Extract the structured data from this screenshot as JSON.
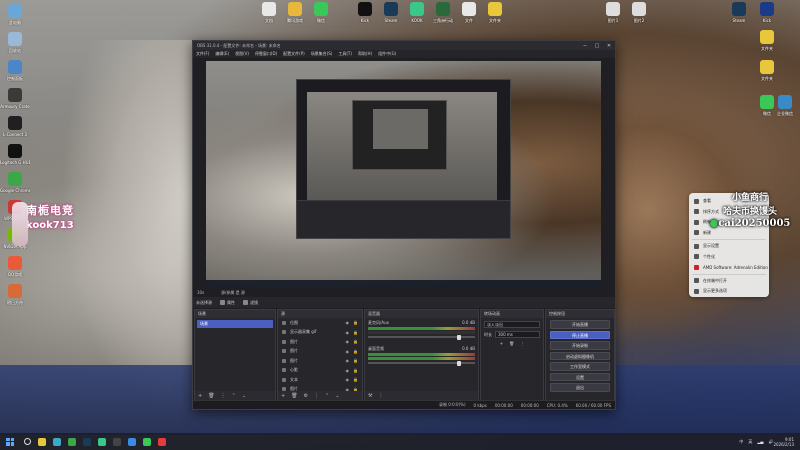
{
  "desktop": {
    "left_icons": [
      {
        "label": "此电脑",
        "color": "#6aa6d8"
      },
      {
        "label": "回收站",
        "color": "#9ab8d8"
      },
      {
        "label": "控制面板",
        "color": "#4a86c8"
      },
      {
        "label": "Armoury Crate",
        "color": "#3a3a3a"
      },
      {
        "label": "L-Connect 3",
        "color": "#202020"
      },
      {
        "label": "Logitech G HUB",
        "color": "#111"
      },
      {
        "label": "Google Chrome",
        "color": "#3aa848"
      },
      {
        "label": "WPS Office",
        "color": "#c83a3a"
      },
      {
        "label": "NVIDIA App",
        "color": "#76b900"
      },
      {
        "label": "QQ游戏",
        "color": "#e85a3a"
      },
      {
        "label": "明日方舟",
        "color": "#d86a3a"
      }
    ],
    "top_icons": [
      {
        "label": "文档",
        "color": "#e8e8e8"
      },
      {
        "label": "腾讯游戏",
        "color": "#e8b83a"
      },
      {
        "label": "微信",
        "color": "#3ac858"
      },
      {
        "label": "Kick",
        "color": "#111"
      },
      {
        "label": "Steam",
        "color": "#1a3a5a"
      },
      {
        "label": "KOOK",
        "color": "#3ac88a"
      },
      {
        "label": "三角洲行动",
        "color": "#2a6a3a"
      },
      {
        "label": "文件",
        "color": "#e8e8e8"
      },
      {
        "label": "文件夹",
        "color": "#e8c83a"
      }
    ],
    "right_icons": [
      {
        "label": "图片1",
        "color": "#ddd"
      },
      {
        "label": "图片2",
        "color": "#ddd"
      },
      {
        "label": "Steam",
        "color": "#1a3a5a"
      },
      {
        "label": "Kick",
        "color": "#1a3a8a"
      },
      {
        "label": "文件夹",
        "color": "#e8c83a"
      },
      {
        "label": "微信",
        "color": "#3ac858"
      },
      {
        "label": "文件夹",
        "color": "#e8c83a"
      },
      {
        "label": "企业微信",
        "color": "#3a8ac8"
      }
    ]
  },
  "overlay_left": {
    "line1": "南栀电竞",
    "line2": "kook713"
  },
  "overlay_right": {
    "line1": "小鱼商行",
    "line2": "哈夫币换馒头",
    "line3": "cai20250005"
  },
  "context_menu": {
    "items": [
      "查看",
      "排序方式",
      "刷新",
      "新建",
      "显示设置",
      "个性化",
      "AMD Software: Adrenalin Edition",
      "在终端中打开",
      "显示更多选项"
    ]
  },
  "obs": {
    "title": "OBS 31.0.4 - 配置文件: 未命名 - 场景: 未命名",
    "menu": [
      "文件(F)",
      "编辑(E)",
      "视图(V)",
      "停靠窗口(D)",
      "配置文件(P)",
      "场景集合(S)",
      "工具(T)",
      "帮助(H)",
      "组件中(G)"
    ],
    "tabs": [
      "10s",
      "源/参属 是 源"
    ],
    "sub_label": "未选择源",
    "sub_buttons": [
      "属性",
      "滤镜"
    ],
    "docks": {
      "scenes": {
        "title": "场景",
        "items": [
          "场景"
        ]
      },
      "sources": {
        "title": "源",
        "items": [
          "位图",
          "显示器采集 gif",
          "图片",
          "图片",
          "图片",
          "心脏",
          "文本",
          "图片"
        ]
      },
      "mixer": {
        "title": "混音器",
        "tracks": [
          {
            "name": "麦克风/Aux",
            "db": "0.0 dB"
          },
          {
            "name": "桌面音频",
            "db": "0.0 dB"
          }
        ]
      },
      "transitions": {
        "title": "转场动画",
        "type": "淡入淡出",
        "duration_label": "时长",
        "duration": "300 ms"
      },
      "controls": {
        "title": "控制按钮",
        "buttons": [
          "开始直播",
          "停止直播",
          "开始录制",
          "启动虚拟摄像机",
          "工作室模式",
          "设置",
          "退出"
        ]
      }
    },
    "status": [
      "录制 0:0:0(%)",
      "0 kbps",
      "00:00:00",
      "00:00:00",
      "CPU: 0.4%",
      "60.00 / 60.00 FPS"
    ]
  },
  "taskbar": {
    "apps": [
      {
        "name": "File Explorer",
        "color": "#e8c83a"
      },
      {
        "name": "Edge",
        "color": "#3aa8c8"
      },
      {
        "name": "Chrome",
        "color": "#3aa848"
      },
      {
        "name": "Steam",
        "color": "#1a3a5a"
      },
      {
        "name": "KOOK",
        "color": "#3ac88a"
      },
      {
        "name": "OBS",
        "color": "#444"
      },
      {
        "name": "QQ",
        "color": "#3a8ae8"
      },
      {
        "name": "WeChat",
        "color": "#3ac858"
      },
      {
        "name": "Music",
        "color": "#e83a3a"
      }
    ],
    "tray": [
      "中",
      "英"
    ],
    "time": "9:01",
    "date": "2026/2/13"
  }
}
